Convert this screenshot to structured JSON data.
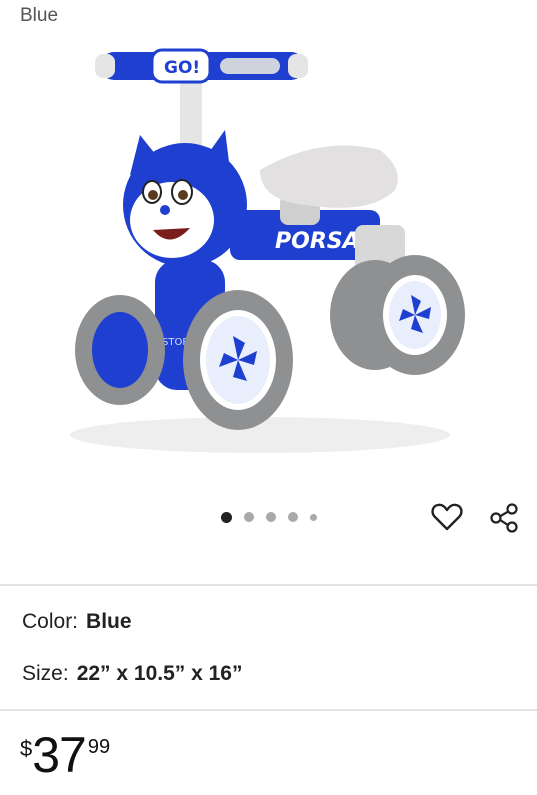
{
  "variant_label": "Blue",
  "product_image": {
    "brand_text": "PORSAPIM",
    "handle_badge": "GO!",
    "seat_logo": "STORT",
    "colors": {
      "body": "#1f3fd1",
      "tire": "#8f9092",
      "seat": "#e2e0e0"
    }
  },
  "carousel": {
    "count": 5,
    "active_index": 0
  },
  "actions": {
    "favorite_icon": "heart-icon",
    "share_icon": "share-icon"
  },
  "attributes": {
    "color": {
      "label": "Color:",
      "value": "Blue"
    },
    "size": {
      "label": "Size:",
      "value": "22” x 10.5” x 16”"
    }
  },
  "price": {
    "currency": "$",
    "dollars": "37",
    "cents": "99"
  }
}
